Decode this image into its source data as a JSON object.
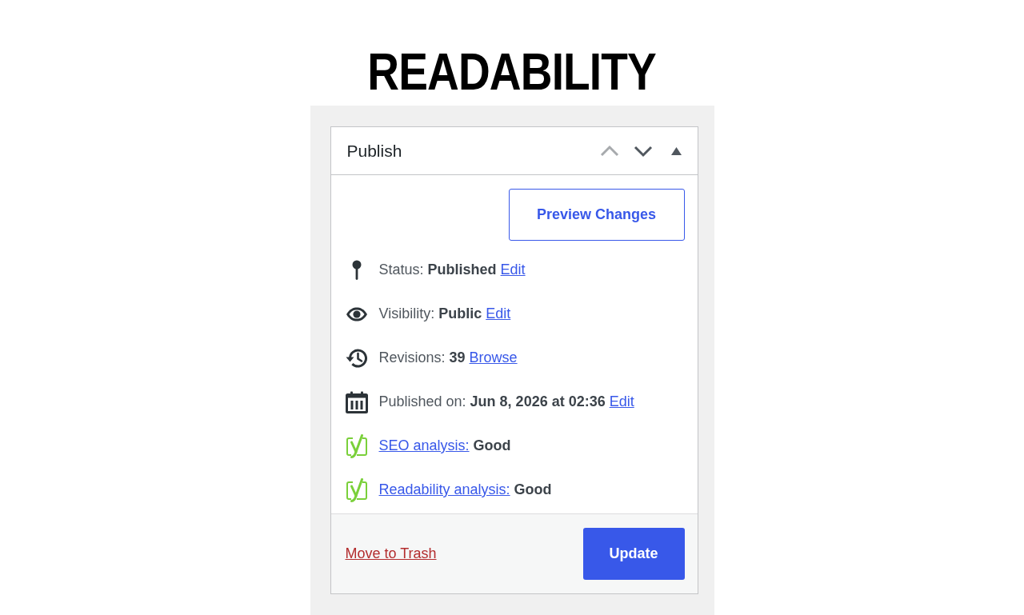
{
  "heading": "READABILITY",
  "panel": {
    "title": "Publish",
    "header_controls": [
      {
        "kind": "move-up",
        "disabled": true
      },
      {
        "kind": "move-down",
        "disabled": false
      },
      {
        "kind": "toggle",
        "expanded": true
      }
    ],
    "preview_button": "Preview Changes",
    "rows": [
      {
        "kind": "pin",
        "label": "Status:",
        "value": "Published",
        "link": "Edit"
      },
      {
        "kind": "eye",
        "label": "Visibility:",
        "value": "Public",
        "link": "Edit"
      },
      {
        "kind": "history",
        "label": "Revisions:",
        "value": "39",
        "link": "Browse"
      },
      {
        "kind": "calendar",
        "label": "Published on:",
        "value": "Jun 8, 2026 at 02:36",
        "link": "Edit"
      },
      {
        "kind": "score",
        "link": "SEO analysis:",
        "value": "Good"
      },
      {
        "kind": "score",
        "link": "Readability analysis:",
        "value": "Good"
      }
    ],
    "footer": {
      "trash_link": "Move to Trash",
      "update_button": "Update"
    }
  }
}
